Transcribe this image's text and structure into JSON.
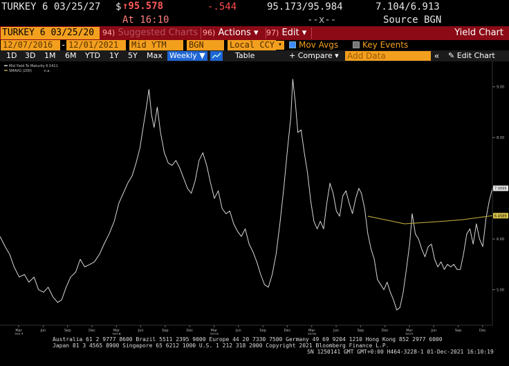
{
  "quote": {
    "security": "TURKEY 6 03/25/27",
    "price_prefix": "$",
    "last_price": "↑95.578",
    "change": "-.544",
    "bid_ask": "95.173/95.984",
    "yields": "7.104/6.913",
    "time": "At 16:10",
    "size": "--x--",
    "source": "Source BGN"
  },
  "toolbar": {
    "title": "TURKEY 6 03/25/20",
    "suggested": {
      "num": "94)",
      "label": "Suggested Charts"
    },
    "actions": {
      "num": "96)",
      "label": "Actions ▾"
    },
    "edit": {
      "num": "97)",
      "label": "Edit ▾"
    },
    "function": "Yield Chart"
  },
  "settings": {
    "start_date": "12/07/2016",
    "dash": "-",
    "end_date": "12/01/2021",
    "field": "Mid YTM",
    "source": "BGN",
    "currency": "Local CCY",
    "mov_avgs_label": "Mov Avgs",
    "mov_avgs_checked": true,
    "key_events_label": "Key Events",
    "key_events_checked": false
  },
  "ranges": {
    "items": [
      "1D",
      "3D",
      "1M",
      "6M",
      "YTD",
      "1Y",
      "5Y",
      "Max"
    ],
    "frequency": "Weekly ▼",
    "table": "Table",
    "compare": "+ Compare ▾",
    "add_data_placeholder": "Add Data",
    "collapse": "«",
    "edit_chart": "✎ Edit Chart"
  },
  "legend": {
    "series1": {
      "name": "Mid Yield To Maturity",
      "value": "6.5411"
    },
    "series2": {
      "name": "SMAVG (200)",
      "value": "n.a."
    }
  },
  "chart_data": {
    "type": "line",
    "x_start": "2016-12-07",
    "x_end": "2021-12-01",
    "ylim": [
      4.3,
      9.5
    ],
    "y_ticks": [
      "9.00",
      "8.00",
      "7.00",
      "6.00",
      "5.00"
    ],
    "y_tick_values": [
      9,
      8,
      7,
      6,
      5
    ],
    "last_value_label": "7.0099",
    "ma_value_label": "6.4589",
    "x_labels": [
      "Mar",
      "Jun",
      "Sep",
      "Dec",
      "Mar",
      "Jun",
      "Sep",
      "Dec",
      "Mar",
      "Jun",
      "Sep",
      "Dec",
      "Mar",
      "Jun",
      "Sep",
      "Dec",
      "Mar",
      "Jun",
      "Sep",
      "Dec"
    ],
    "year_labels": [
      {
        "text": "2017",
        "month": 3
      },
      {
        "text": "2018",
        "month": 15
      },
      {
        "text": "2019",
        "month": 27
      },
      {
        "text": "2020",
        "month": 39
      },
      {
        "text": "2021",
        "month": 51
      }
    ],
    "series": [
      {
        "name": "Mid Yield To Maturity",
        "color": "#d8d8d8",
        "points": [
          [
            0.0,
            6.05
          ],
          [
            0.8,
            5.85
          ],
          [
            1.5,
            5.7
          ],
          [
            2.2,
            5.45
          ],
          [
            3.0,
            5.25
          ],
          [
            3.8,
            5.3
          ],
          [
            4.5,
            5.15
          ],
          [
            5.3,
            5.25
          ],
          [
            6.0,
            5.0
          ],
          [
            6.8,
            4.95
          ],
          [
            7.5,
            5.05
          ],
          [
            8.3,
            4.85
          ],
          [
            9.0,
            4.75
          ],
          [
            9.6,
            4.8
          ],
          [
            10.3,
            5.05
          ],
          [
            11.0,
            5.25
          ],
          [
            11.8,
            5.35
          ],
          [
            12.5,
            5.6
          ],
          [
            13.2,
            5.45
          ],
          [
            14.0,
            5.5
          ],
          [
            14.7,
            5.55
          ],
          [
            15.5,
            5.7
          ],
          [
            16.2,
            5.9
          ],
          [
            17.0,
            6.1
          ],
          [
            17.8,
            6.35
          ],
          [
            18.5,
            6.7
          ],
          [
            19.2,
            6.9
          ],
          [
            19.9,
            7.1
          ],
          [
            20.6,
            7.25
          ],
          [
            21.2,
            7.5
          ],
          [
            21.8,
            7.8
          ],
          [
            22.3,
            8.2
          ],
          [
            22.8,
            8.6
          ],
          [
            23.2,
            8.95
          ],
          [
            23.6,
            8.45
          ],
          [
            24.0,
            8.2
          ],
          [
            24.5,
            8.6
          ],
          [
            25.0,
            8.1
          ],
          [
            25.6,
            7.7
          ],
          [
            26.2,
            7.5
          ],
          [
            26.8,
            7.45
          ],
          [
            27.4,
            7.55
          ],
          [
            28.0,
            7.4
          ],
          [
            28.6,
            7.2
          ],
          [
            29.2,
            7.0
          ],
          [
            29.8,
            6.9
          ],
          [
            30.4,
            7.15
          ],
          [
            31.0,
            7.55
          ],
          [
            31.6,
            7.7
          ],
          [
            32.2,
            7.45
          ],
          [
            32.8,
            7.1
          ],
          [
            33.4,
            6.8
          ],
          [
            34.0,
            6.95
          ],
          [
            34.6,
            6.6
          ],
          [
            35.2,
            6.5
          ],
          [
            35.8,
            6.55
          ],
          [
            36.4,
            6.3
          ],
          [
            37.0,
            6.15
          ],
          [
            37.6,
            6.05
          ],
          [
            38.2,
            6.2
          ],
          [
            38.8,
            5.9
          ],
          [
            39.4,
            5.75
          ],
          [
            40.0,
            5.55
          ],
          [
            40.6,
            5.3
          ],
          [
            41.2,
            5.1
          ],
          [
            41.8,
            5.05
          ],
          [
            42.4,
            5.3
          ],
          [
            43.0,
            5.7
          ],
          [
            43.6,
            6.3
          ],
          [
            44.2,
            7.0
          ],
          [
            44.8,
            7.8
          ],
          [
            45.3,
            8.4
          ],
          [
            45.6,
            9.15
          ],
          [
            46.0,
            8.7
          ],
          [
            46.4,
            8.1
          ],
          [
            46.9,
            8.15
          ],
          [
            47.4,
            7.7
          ],
          [
            47.9,
            7.3
          ],
          [
            48.4,
            6.75
          ],
          [
            48.9,
            6.35
          ],
          [
            49.4,
            6.2
          ],
          [
            49.9,
            6.35
          ],
          [
            50.4,
            6.2
          ],
          [
            50.9,
            6.7
          ],
          [
            51.4,
            7.1
          ],
          [
            51.9,
            6.9
          ],
          [
            52.4,
            6.55
          ],
          [
            52.9,
            6.45
          ],
          [
            53.4,
            6.85
          ],
          [
            53.9,
            6.95
          ],
          [
            54.4,
            6.7
          ],
          [
            54.9,
            6.5
          ],
          [
            55.4,
            6.8
          ],
          [
            55.9,
            7.0
          ],
          [
            56.3,
            6.9
          ],
          [
            56.8,
            6.6
          ],
          [
            57.3,
            6.1
          ],
          [
            57.8,
            5.8
          ],
          [
            58.3,
            5.6
          ],
          [
            58.8,
            5.2
          ],
          [
            59.3,
            5.1
          ],
          [
            59.8,
            5.0
          ],
          [
            60.3,
            5.15
          ],
          [
            60.8,
            4.95
          ],
          [
            61.3,
            4.8
          ],
          [
            61.8,
            4.6
          ],
          [
            62.3,
            4.65
          ],
          [
            62.8,
            4.95
          ],
          [
            63.3,
            5.4
          ],
          [
            63.8,
            5.9
          ],
          [
            64.2,
            6.5
          ],
          [
            64.7,
            6.1
          ],
          [
            65.2,
            6.0
          ],
          [
            65.7,
            5.8
          ],
          [
            66.2,
            5.65
          ],
          [
            66.7,
            5.85
          ],
          [
            67.2,
            5.9
          ],
          [
            67.7,
            5.6
          ],
          [
            68.2,
            5.45
          ],
          [
            68.7,
            5.55
          ],
          [
            69.2,
            5.4
          ],
          [
            69.7,
            5.5
          ],
          [
            70.2,
            5.45
          ],
          [
            70.7,
            5.5
          ],
          [
            71.2,
            5.4
          ],
          [
            71.7,
            5.4
          ],
          [
            72.2,
            5.7
          ],
          [
            72.7,
            6.1
          ],
          [
            73.2,
            6.2
          ],
          [
            73.7,
            5.9
          ],
          [
            74.2,
            6.3
          ],
          [
            74.7,
            6.0
          ],
          [
            75.2,
            5.85
          ],
          [
            75.7,
            6.4
          ],
          [
            76.2,
            6.75
          ],
          [
            76.7,
            7.0
          ]
        ]
      },
      {
        "name": "SMAVG (200)",
        "color": "#b8a33a",
        "points": [
          [
            57.3,
            6.45
          ],
          [
            63.0,
            6.3
          ],
          [
            68.0,
            6.34
          ],
          [
            72.0,
            6.38
          ],
          [
            76.7,
            6.46
          ]
        ]
      }
    ]
  },
  "footer": {
    "line1": "Australia 61 2 9777 8600 Brazil 5511 2395 9000 Europe 44 20 7330 7500 Germany 49 69 9204 1210 Hong Kong 852 2977 6000",
    "line2": "Japan 81 3 4565 8900       Singapore 65 6212 1000      U.S. 1 212 318 2000         Copyright 2021 Bloomberg Finance L.P.",
    "line3": "SN 1250141 GMT  GMT+0:00 H464-3228-1 01-Dec-2021 16:10:19"
  }
}
